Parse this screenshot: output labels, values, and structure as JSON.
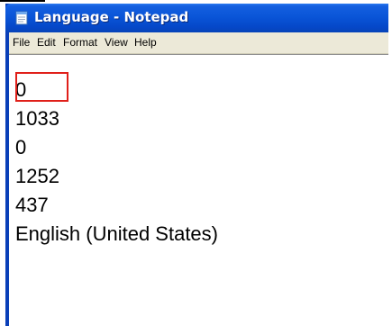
{
  "window": {
    "title": "Language - Notepad"
  },
  "menu": {
    "items": [
      {
        "label": "File"
      },
      {
        "label": "Edit"
      },
      {
        "label": "Format"
      },
      {
        "label": "View"
      },
      {
        "label": "Help"
      }
    ]
  },
  "editor": {
    "lines": [
      "0",
      "1033",
      "0",
      "1252",
      "437",
      "English (United States)"
    ]
  },
  "annotation": {
    "highlight_color": "#e0201a"
  },
  "icons": {
    "app": "notepad-icon"
  }
}
